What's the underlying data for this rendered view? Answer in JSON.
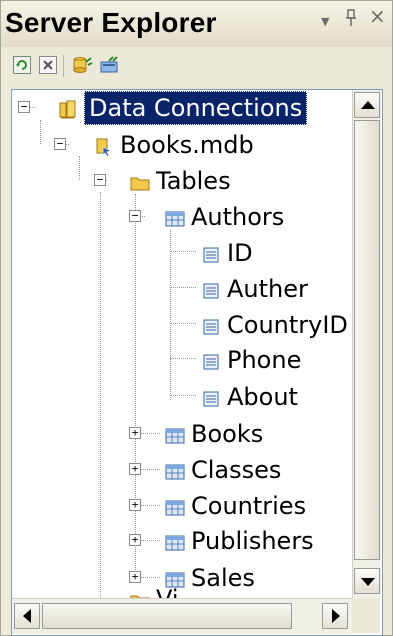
{
  "panel": {
    "title": "Server Explorer",
    "pin_glyph": "ᵽ",
    "dropdown_glyph": "▼",
    "close_glyph": "×"
  },
  "toolbar": {
    "icons": [
      "refresh-icon",
      "stop-refresh-icon",
      "connect-to-database-icon",
      "connect-to-server-icon"
    ]
  },
  "tree": {
    "root": {
      "label": "Data Connections",
      "expander": "−"
    },
    "connection": {
      "label": "Books.mdb",
      "expander": "−"
    },
    "tables_folder": {
      "label": "Tables",
      "expander": "−"
    },
    "authors": {
      "label": "Authors",
      "expander": "−"
    },
    "columns": [
      "ID",
      "Auther",
      "CountryID",
      "Phone",
      "About"
    ],
    "tables": [
      {
        "label": "Books",
        "expander": "+"
      },
      {
        "label": "Classes",
        "expander": "+"
      },
      {
        "label": "Countries",
        "expander": "+"
      },
      {
        "label": "Publishers",
        "expander": "+"
      },
      {
        "label": "Sales",
        "expander": "+"
      }
    ],
    "partial_label": "Vi"
  },
  "colors": {
    "selection": "#0a246a",
    "folder": "#f2c94c",
    "table_icon": "#7ea8e0",
    "tree_lines": "#9a9a9a"
  }
}
